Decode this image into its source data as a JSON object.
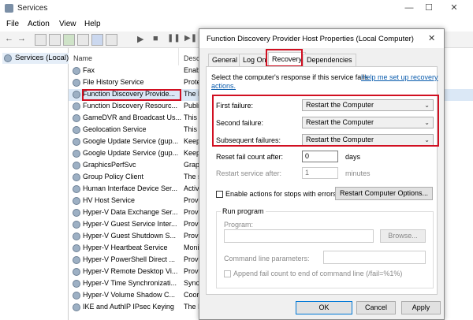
{
  "window": {
    "title": "Services",
    "minimize": "—",
    "maximize": "☐",
    "close": "✕"
  },
  "menu": [
    "File",
    "Action",
    "View",
    "Help"
  ],
  "nav": {
    "label": "Services (Local)"
  },
  "list": {
    "col_name": "Name",
    "col_desc": "Descr",
    "rows": [
      {
        "name": "Fax",
        "desc": "Enab"
      },
      {
        "name": "File History Service",
        "desc": "Prote"
      },
      {
        "name": "Function Discovery Provide...",
        "desc": "The F"
      },
      {
        "name": "Function Discovery Resourc...",
        "desc": "Publi"
      },
      {
        "name": "GameDVR and Broadcast Us...",
        "desc": "This u"
      },
      {
        "name": "Geolocation Service",
        "desc": "This s"
      },
      {
        "name": "Google Update Service (gup...",
        "desc": "Keeps"
      },
      {
        "name": "Google Update Service (gup...",
        "desc": "Keeps"
      },
      {
        "name": "GraphicsPerfSvc",
        "desc": "Graph"
      },
      {
        "name": "Group Policy Client",
        "desc": "The s"
      },
      {
        "name": "Human Interface Device Ser...",
        "desc": "Activ"
      },
      {
        "name": "HV Host Service",
        "desc": "Provi"
      },
      {
        "name": "Hyper-V Data Exchange Ser...",
        "desc": "Provi"
      },
      {
        "name": "Hyper-V Guest Service Inter...",
        "desc": "Provi"
      },
      {
        "name": "Hyper-V Guest Shutdown S...",
        "desc": "Provi"
      },
      {
        "name": "Hyper-V Heartbeat Service",
        "desc": "Moni"
      },
      {
        "name": "Hyper-V PowerShell Direct ...",
        "desc": "Provi"
      },
      {
        "name": "Hyper-V Remote Desktop Vi...",
        "desc": "Provi"
      },
      {
        "name": "Hyper-V Time Synchronizati...",
        "desc": "Synch"
      },
      {
        "name": "Hyper-V Volume Shadow C...",
        "desc": "Coor"
      },
      {
        "name": "IKE and AuthIP IPsec Keying",
        "desc": "The I"
      }
    ]
  },
  "dialog": {
    "title": "Function Discovery Provider Host Properties (Local Computer)",
    "close": "✕",
    "tabs": [
      "General",
      "Log On",
      "Recovery",
      "Dependencies"
    ],
    "intro": "Select the computer's response if this service fails.",
    "help_link_1": "Help me set up recovery",
    "help_link_2": "actions.",
    "first_failure_label": "First failure:",
    "first_failure_value": "Restart the Computer",
    "second_failure_label": "Second failure:",
    "second_failure_value": "Restart the Computer",
    "subsequent_failures_label": "Subsequent failures:",
    "subsequent_failures_value": "Restart the Computer",
    "reset_label": "Reset fail count after:",
    "reset_value": "0",
    "reset_unit": "days",
    "restart_label": "Restart service after:",
    "restart_value": "1",
    "restart_unit": "minutes",
    "enable_actions_label": "Enable actions for stops with errors.",
    "restart_options_button": "Restart Computer Options...",
    "run_program_label": "Run program",
    "program_label": "Program:",
    "browse_button": "Browse...",
    "cmd_params_label": "Command line parameters:",
    "append_label": "Append fail count to end of command line (/fail=%1%)",
    "ok_button": "OK",
    "cancel_button": "Cancel",
    "apply_button": "Apply"
  },
  "colors": {
    "highlight": "#d10f21",
    "link": "#0b5cad"
  }
}
